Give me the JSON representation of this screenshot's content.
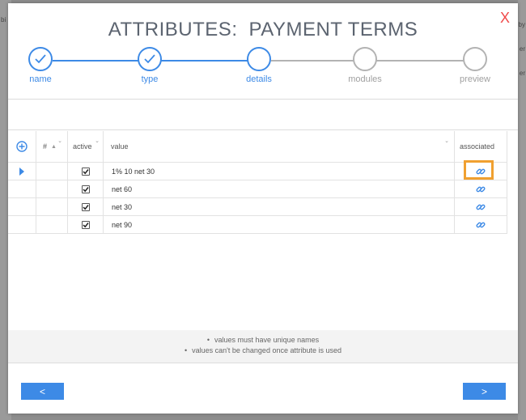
{
  "modal": {
    "close_label": "X",
    "title_part1": "ATTRIBUTES:",
    "title_part2": "PAYMENT TERMS"
  },
  "stepper": {
    "steps": [
      {
        "label": "name",
        "state": "done"
      },
      {
        "label": "type",
        "state": "done"
      },
      {
        "label": "details",
        "state": "current"
      },
      {
        "label": "modules",
        "state": "todo"
      },
      {
        "label": "preview",
        "state": "todo"
      }
    ]
  },
  "table": {
    "headers": {
      "num": "#",
      "active": "active",
      "value": "value",
      "associated": "associated"
    },
    "rows": [
      {
        "active": true,
        "value": "1% 10 net 30"
      },
      {
        "active": true,
        "value": "net 60"
      },
      {
        "active": true,
        "value": "net 30"
      },
      {
        "active": true,
        "value": "net 90"
      }
    ]
  },
  "notes": [
    "values must have unique names",
    "values can't be changed once attribute is used"
  ],
  "nav": {
    "prev_label": "<",
    "next_label": ">"
  },
  "colors": {
    "accent": "#3d8ae6",
    "close": "#f04a4a",
    "highlight": "#f0a030"
  },
  "background": {
    "left_edge": "bi",
    "right_edge_1": "by",
    "right_edge_2": "er",
    "right_edge_3": "er"
  }
}
